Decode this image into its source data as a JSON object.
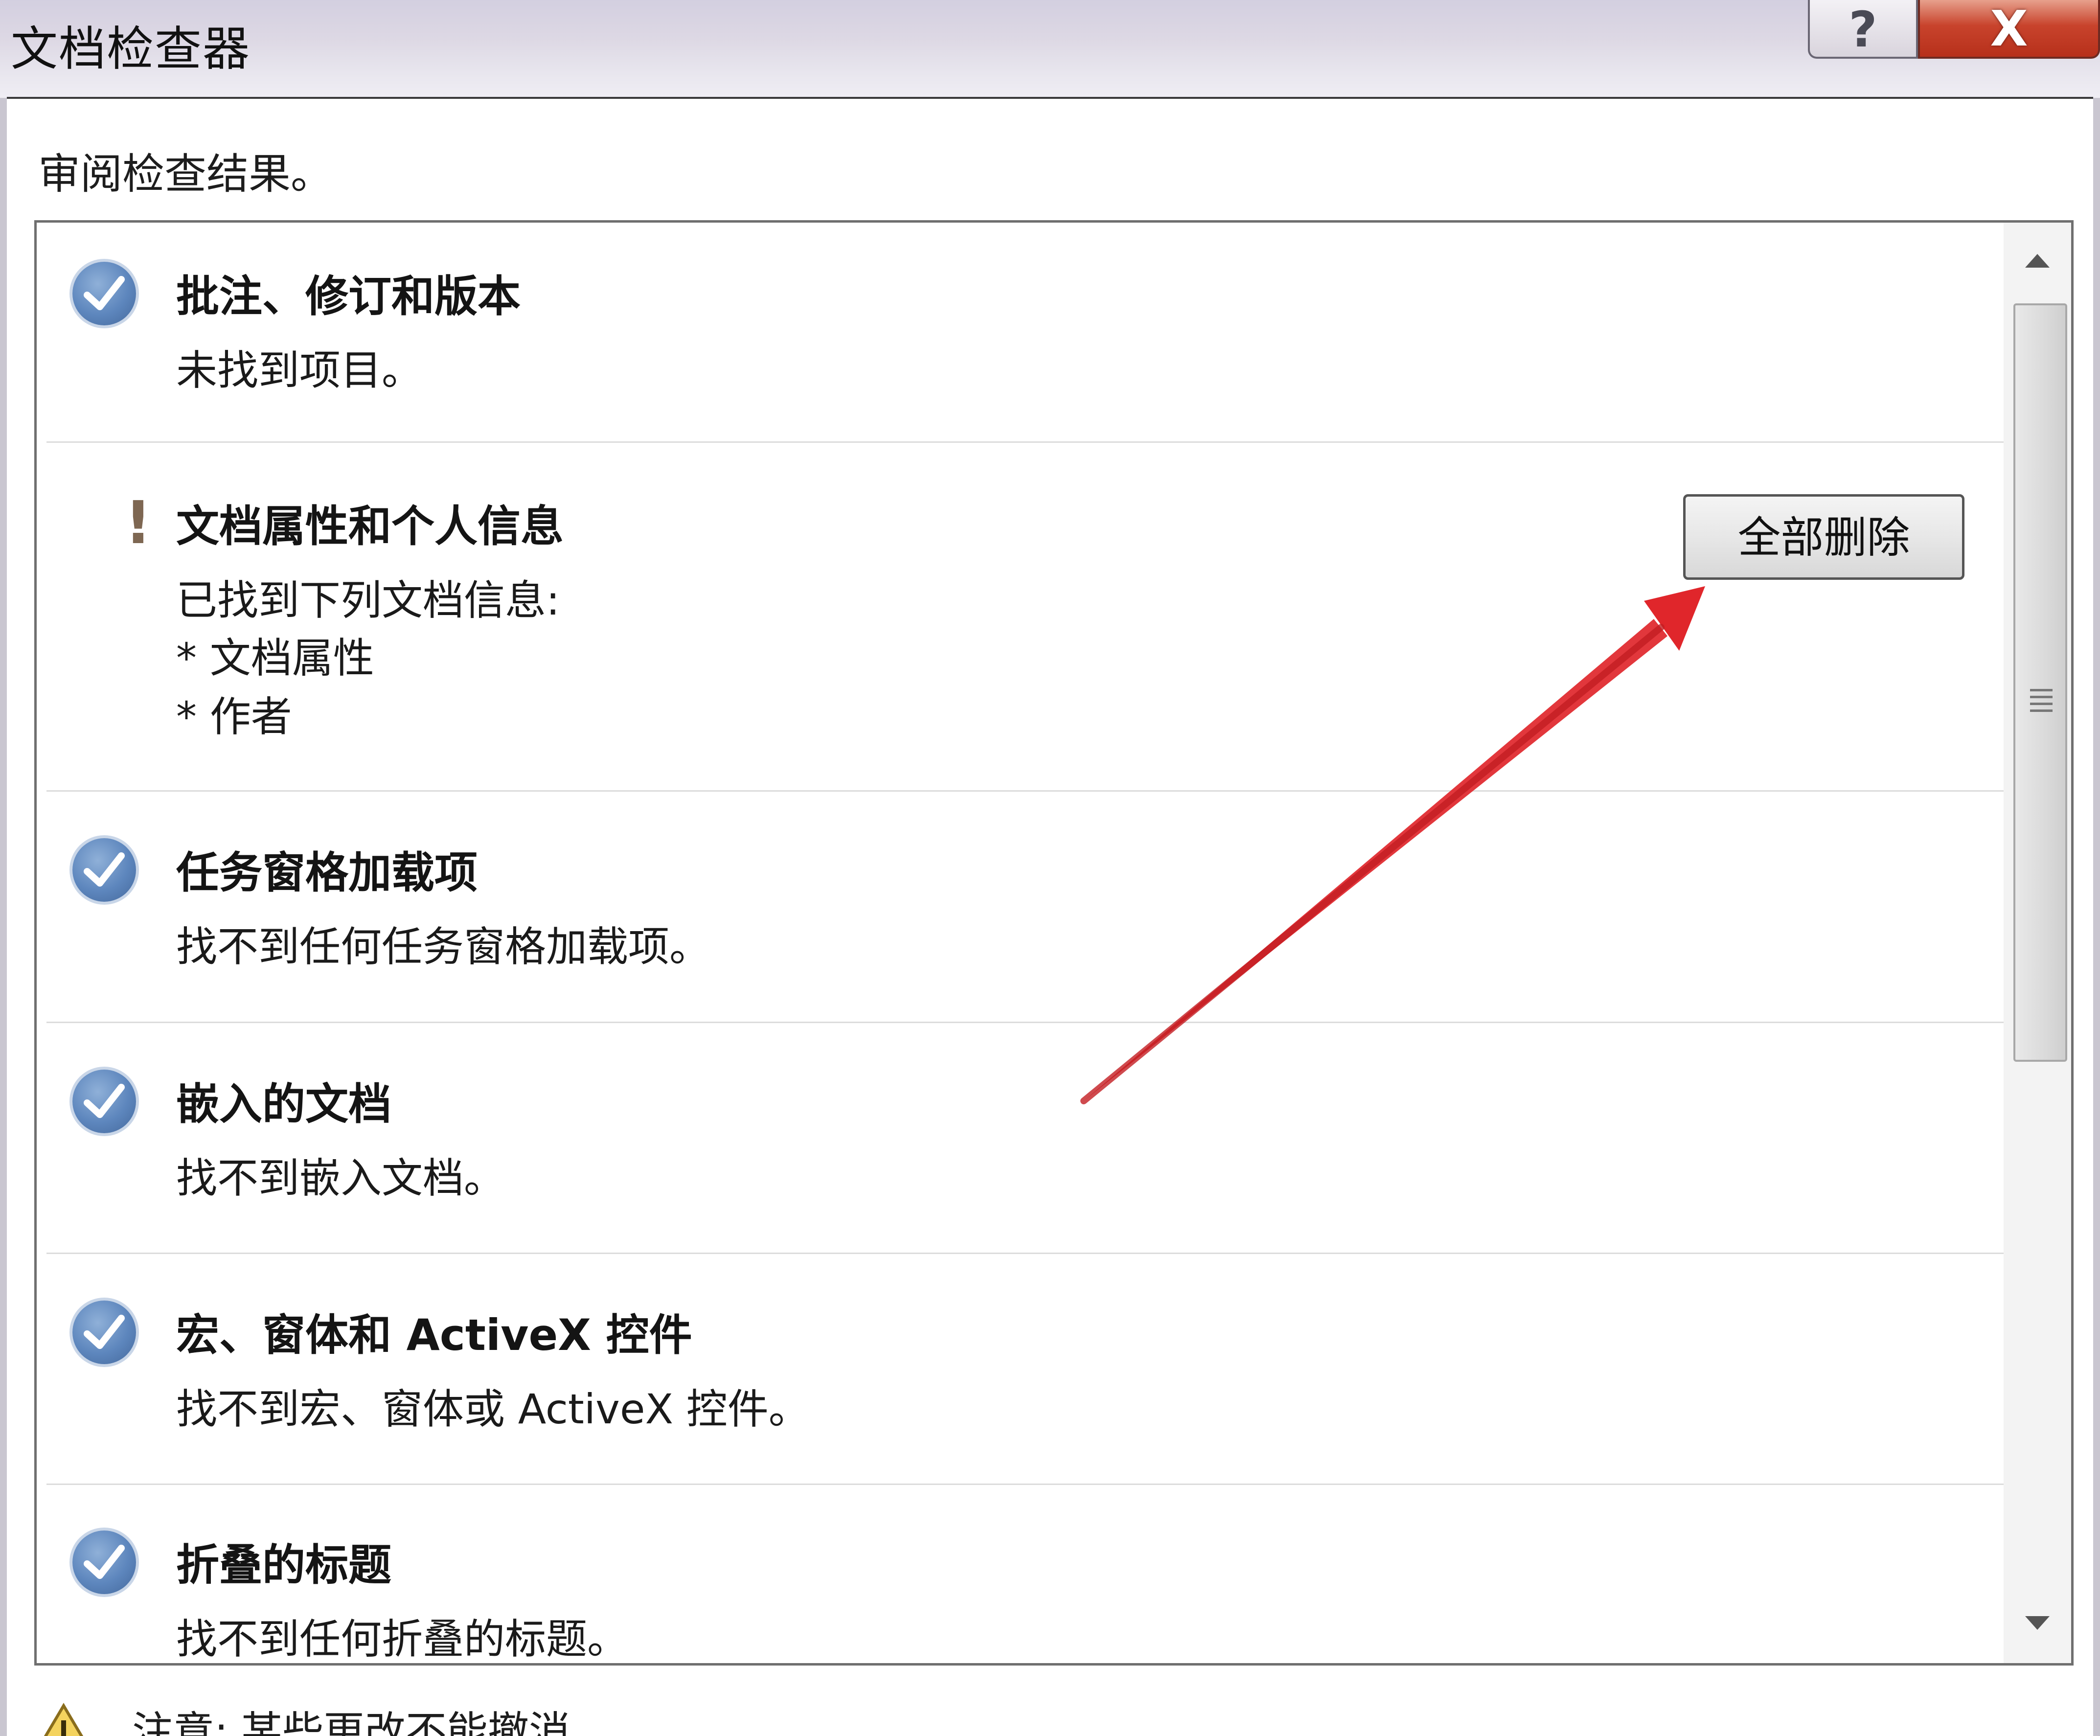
{
  "window": {
    "title": "文档检查器",
    "help_label": "?",
    "close_label": "X"
  },
  "subtitle": "审阅检查结果。",
  "items": [
    {
      "status": "check-icon",
      "title": "批注、修订和版本",
      "description": "未找到项目。"
    },
    {
      "status": "warning-icon",
      "status_glyph": "!",
      "title": "文档属性和个人信息",
      "description": "已找到下列文档信息:",
      "details": [
        "* 文档属性",
        "* 作者"
      ],
      "action_label": "全部删除"
    },
    {
      "status": "check-icon",
      "title": "任务窗格加载项",
      "description": "找不到任何任务窗格加载项。"
    },
    {
      "status": "check-icon",
      "title": "嵌入的文档",
      "description": "找不到嵌入文档。"
    },
    {
      "status": "check-icon",
      "title": "宏、窗体和 ActiveX 控件",
      "description": "找不到宏、窗体或 ActiveX 控件。"
    },
    {
      "status": "check-icon",
      "title": "折叠的标题",
      "description": "找不到任何折叠的标题。"
    }
  ],
  "footer": {
    "note": "注意: 某些更改不能撤消"
  },
  "colors": {
    "check_blue": "#5d86bd",
    "close_red": "#c8432c",
    "annotation_arrow": "#e0262b"
  }
}
